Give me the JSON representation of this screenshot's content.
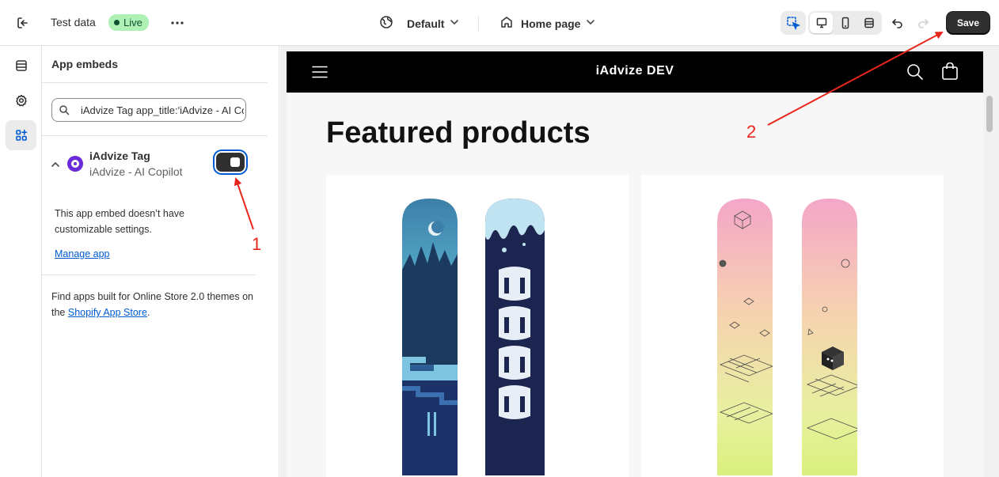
{
  "topbar": {
    "store_name": "Test data",
    "status_badge": "Live",
    "theme": "Default",
    "page": "Home page",
    "save_label": "Save"
  },
  "sidebar": {
    "title": "App embeds",
    "search_value": "iAdvize Tag app_title:'iAdvize - AI Copilot'",
    "embed": {
      "name": "iAdvize Tag",
      "app": "iAdvize - AI Copilot",
      "enabled": true,
      "note": "This app embed doesn’t have customizable settings.",
      "manage_link": "Manage app"
    },
    "footer": {
      "text_before": "Find apps built for Online Store 2.0 themes on the ",
      "link": "Shopify App Store",
      "text_after": "."
    }
  },
  "preview": {
    "store_title": "iAdvize DEV",
    "section_heading": "Featured products"
  },
  "annotations": {
    "marker_1": "1",
    "marker_2": "2",
    "color": "#e8271c"
  },
  "colors": {
    "save_bg": "#303030",
    "live_badge_bg": "#aff0b5",
    "accent_focus": "#005bd3",
    "store_header_bg": "#000000"
  },
  "icons": [
    "exit-icon",
    "more-icon",
    "globe-icon",
    "home-icon",
    "chevron-down-icon",
    "inspector-icon",
    "desktop-icon",
    "mobile-icon",
    "fullscreen-icon",
    "undo-icon",
    "redo-icon",
    "sections-icon",
    "gear-icon",
    "apps-icon",
    "search-icon",
    "cart-icon",
    "menu-icon"
  ]
}
